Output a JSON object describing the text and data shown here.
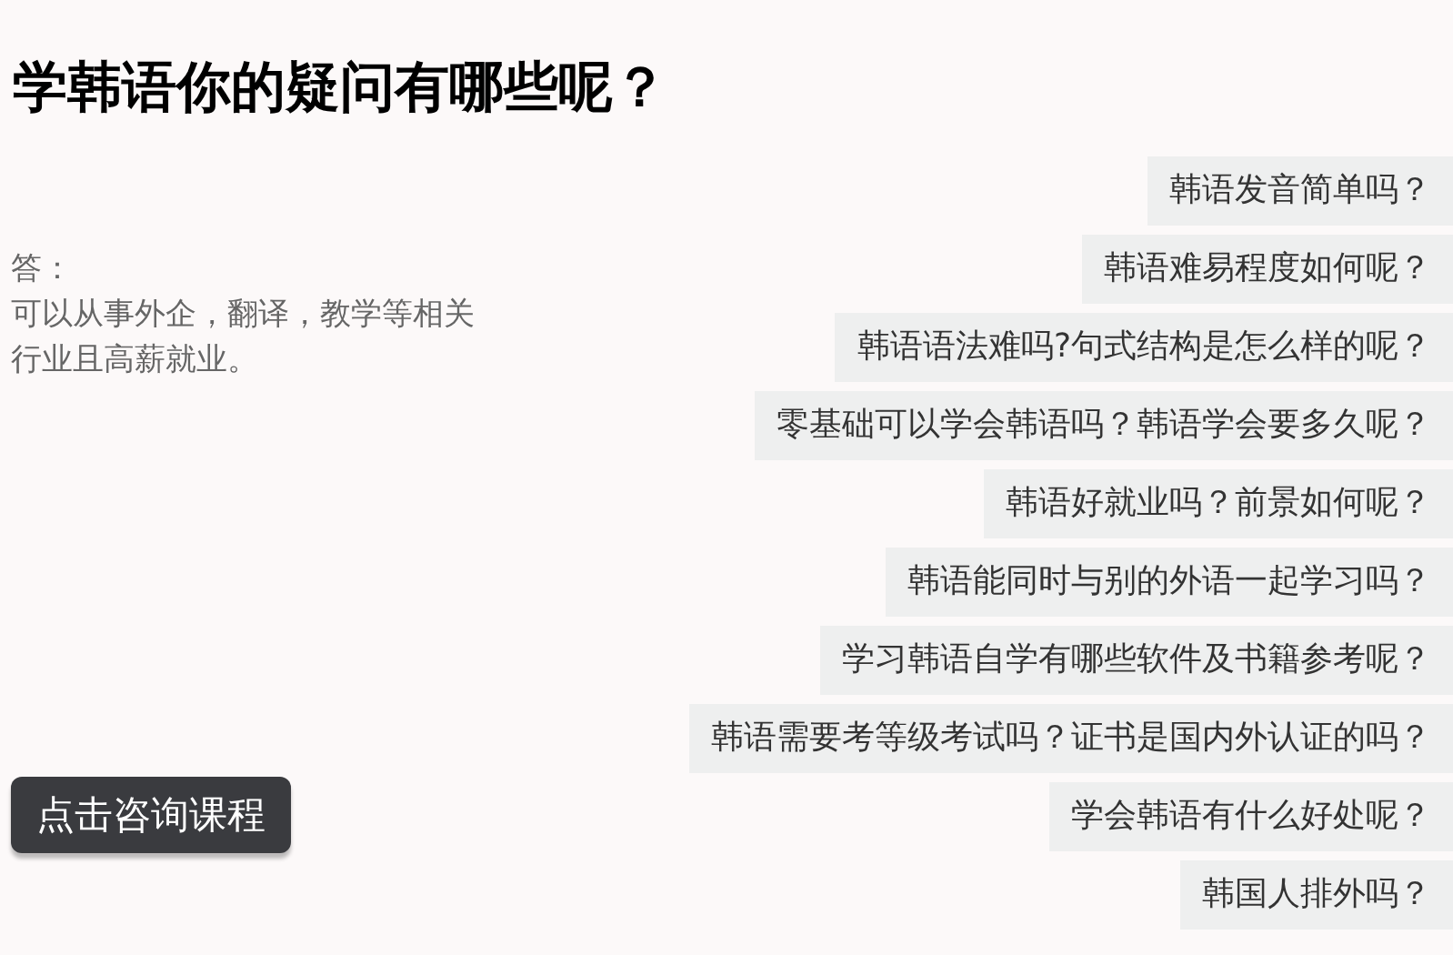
{
  "title": "学韩语你的疑问有哪些呢？",
  "answer": {
    "label": "答：",
    "text": "可以从事外企，翻译，教学等相关行业且高薪就业。"
  },
  "questions": [
    "韩语发音简单吗？",
    "韩语难易程度如何呢？",
    "韩语语法难吗?句式结构是怎么样的呢？",
    "零基础可以学会韩语吗？韩语学会要多久呢？",
    "韩语好就业吗？前景如何呢？",
    "韩语能同时与别的外语一起学习吗？",
    "学习韩语自学有哪些软件及书籍参考呢？",
    "韩语需要考等级考试吗？证书是国内外认证的吗？",
    "学会韩语有什么好处呢？",
    "韩国人排外吗？"
  ],
  "button": "点击咨询课程"
}
